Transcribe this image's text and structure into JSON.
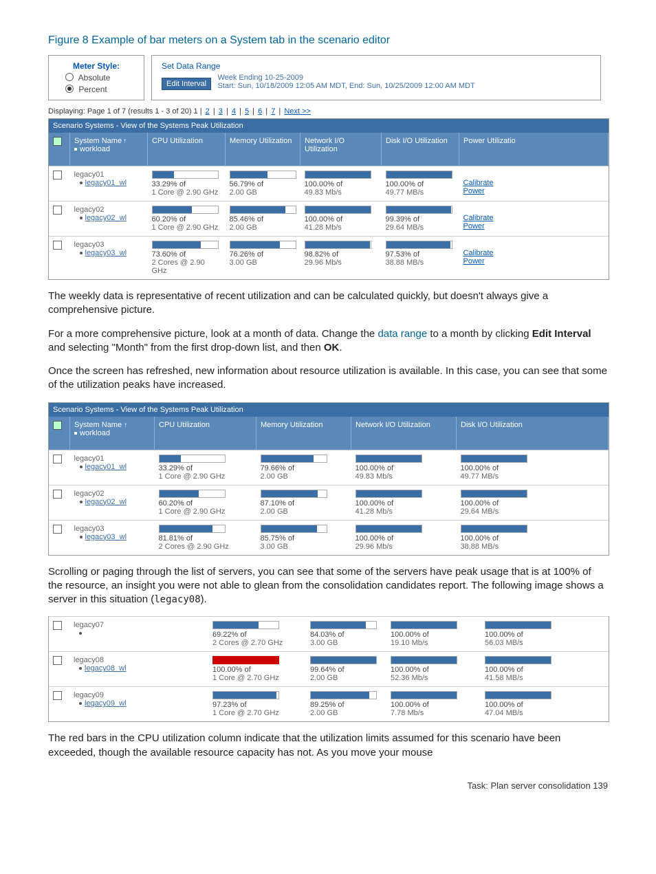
{
  "figure_title": "Figure 8 Example of bar meters on a System tab in the scenario editor",
  "meter_style": {
    "title": "Meter Style:",
    "opt1": "Absolute",
    "opt2": "Percent"
  },
  "data_range": {
    "title": "Set Data Range",
    "edit_btn": "Edit Interval",
    "line1": "Week    Ending  10-25-2009",
    "line2": "Start: Sun, 10/18/2009 12:05 AM MDT, End: Sun, 10/25/2009 12:00 AM MDT"
  },
  "paging": {
    "text": "Displaying: Page 1 of 7 (results 1 - 3 of 20) 1 |",
    "links": [
      "2",
      "3",
      "4",
      "5",
      "6",
      "7"
    ],
    "next": "Next >>"
  },
  "table_title": "Scenario Systems - View of the Systems Peak Utilization",
  "headers1": {
    "sys": "System Name",
    "wl": "workload",
    "cpu": "CPU Utilization",
    "mem": "Memory Utilization",
    "net": "Network I/O Utilization",
    "disk": "Disk I/O Utilization",
    "pow": "Power Utilizatio"
  },
  "calibrate": "Calibrate Power",
  "rows_a": [
    {
      "name": "legacy01",
      "wl": "legacy01_wl",
      "cpu_p": "33.29% of",
      "cpu_s": "1 Core @ 2.90 GHz",
      "cpu_w": 33,
      "mem_p": "56.79% of",
      "mem_s": "2.00  GB",
      "mem_w": 57,
      "net_p": "100.00% of",
      "net_s": "49.83 Mb/s",
      "net_w": 100,
      "disk_p": "100.00% of",
      "disk_s": "49.77 MB/s",
      "disk_w": 100
    },
    {
      "name": "legacy02",
      "wl": "legacy02_wl",
      "cpu_p": "60.20% of",
      "cpu_s": "1 Core @ 2.90 GHz",
      "cpu_w": 60,
      "mem_p": "85.46% of",
      "mem_s": "2.00  GB",
      "mem_w": 85,
      "net_p": "100.00% of",
      "net_s": "41.28 Mb/s",
      "net_w": 100,
      "disk_p": "99.39% of",
      "disk_s": "29.64 MB/s",
      "disk_w": 99
    },
    {
      "name": "legacy03",
      "wl": "legacy03_wl",
      "cpu_p": "73.60% of",
      "cpu_s": "2 Cores @ 2.90 GHz",
      "cpu_w": 74,
      "mem_p": "76.26% of",
      "mem_s": "3.00  GB",
      "mem_w": 76,
      "net_p": "98.82% of",
      "net_s": "29.96 Mb/s",
      "net_w": 99,
      "disk_p": "97.53% of",
      "disk_s": "38.88 MB/s",
      "disk_w": 98
    }
  ],
  "para1": "The weekly data is representative of recent utilization and can be calculated quickly, but doesn't always give a comprehensive picture.",
  "para2a": "For a more comprehensive picture, look at a month of data. Change the ",
  "para2link": "data range",
  "para2b": " to a month by clicking ",
  "para2bold1": "Edit Interval",
  "para2c": " and selecting \"Month\" from the first drop-down list, and then ",
  "para2bold2": "OK",
  "para2d": ".",
  "para3": "Once the screen has refreshed, new information about resource utilization is available. In this case, you can see that some of the utilization peaks have increased.",
  "rows_b": [
    {
      "name": "legacy01",
      "wl": "legacy01_wl",
      "cpu_p": "33.29% of",
      "cpu_s": "1 Core @ 2.90  GHz",
      "cpu_w": 33,
      "mem_p": "79.66% of",
      "mem_s": "2.00  GB",
      "mem_w": 80,
      "net_p": "100.00% of",
      "net_s": "49.83 Mb/s",
      "net_w": 100,
      "disk_p": "100.00% of",
      "disk_s": "49.77 MB/s",
      "disk_w": 100
    },
    {
      "name": "legacy02",
      "wl": "legacy02_wl",
      "cpu_p": "60.20% of",
      "cpu_s": "1 Core @ 2.90  GHz",
      "cpu_w": 60,
      "mem_p": "87.10% of",
      "mem_s": "2.00  GB",
      "mem_w": 87,
      "net_p": "100.00% of",
      "net_s": "41.28 Mb/s",
      "net_w": 100,
      "disk_p": "100.00% of",
      "disk_s": "29.64 MB/s",
      "disk_w": 100
    },
    {
      "name": "legacy03",
      "wl": "legacy03_wl",
      "cpu_p": "81.81% of",
      "cpu_s": "2 Cores @ 2.90  GHz",
      "cpu_w": 82,
      "mem_p": "85.75% of",
      "mem_s": "3.00  GB",
      "mem_w": 86,
      "net_p": "100.00% of",
      "net_s": "29.96 Mb/s",
      "net_w": 100,
      "disk_p": "100.00% of",
      "disk_s": "38.88 MB/s",
      "disk_w": 100
    }
  ],
  "para4a": "Scrolling or paging through the list of servers, you can see that some of the servers have peak usage that is at 100% of the resource, an insight you were not able to glean from the consolidation candidates report. The following image shows a server in this situation (",
  "para4mono": "legacy08",
  "para4b": ").",
  "rows_c": [
    {
      "name": "legacy07",
      "wl": "",
      "cpu_p": "69.22% of",
      "cpu_s": "2 Cores @ 2.70 GHz",
      "cpu_w": 69,
      "cpu_red": false,
      "mem_p": "84.03% of",
      "mem_s": "3.00  GB",
      "mem_w": 84,
      "net_p": "100.00% of",
      "net_s": "19.10 Mb/s",
      "net_w": 100,
      "disk_p": "100.00% of",
      "disk_s": "56.03 MB/s",
      "disk_w": 100
    },
    {
      "name": "legacy08",
      "wl": "legacy08_wl",
      "cpu_p": "100.00% of",
      "cpu_s": "1 Core @ 2.70  GHz",
      "cpu_w": 100,
      "cpu_red": true,
      "mem_p": "99.64% of",
      "mem_s": "2.00  GB",
      "mem_w": 100,
      "net_p": "100.00% of",
      "net_s": "52.36 Mb/s",
      "net_w": 100,
      "disk_p": "100.00% of",
      "disk_s": "41.58 MB/s",
      "disk_w": 100
    },
    {
      "name": "legacy09",
      "wl": "legacy09_wl",
      "cpu_p": "97.23% of",
      "cpu_s": "1 Core @ 2.70  GHz",
      "cpu_w": 97,
      "cpu_red": false,
      "mem_p": "89.25% of",
      "mem_s": "2.00  GB",
      "mem_w": 89,
      "net_p": "100.00% of",
      "net_s": "7.78 Mb/s",
      "net_w": 100,
      "disk_p": "100.00% of",
      "disk_s": "47.04 MB/s",
      "disk_w": 100
    }
  ],
  "para5": "The red bars in the CPU utilization column indicate that the utilization limits assumed for this scenario have been exceeded, though the available resource capacity has not. As you move your mouse",
  "footer": "Task: Plan server consolidation    139"
}
